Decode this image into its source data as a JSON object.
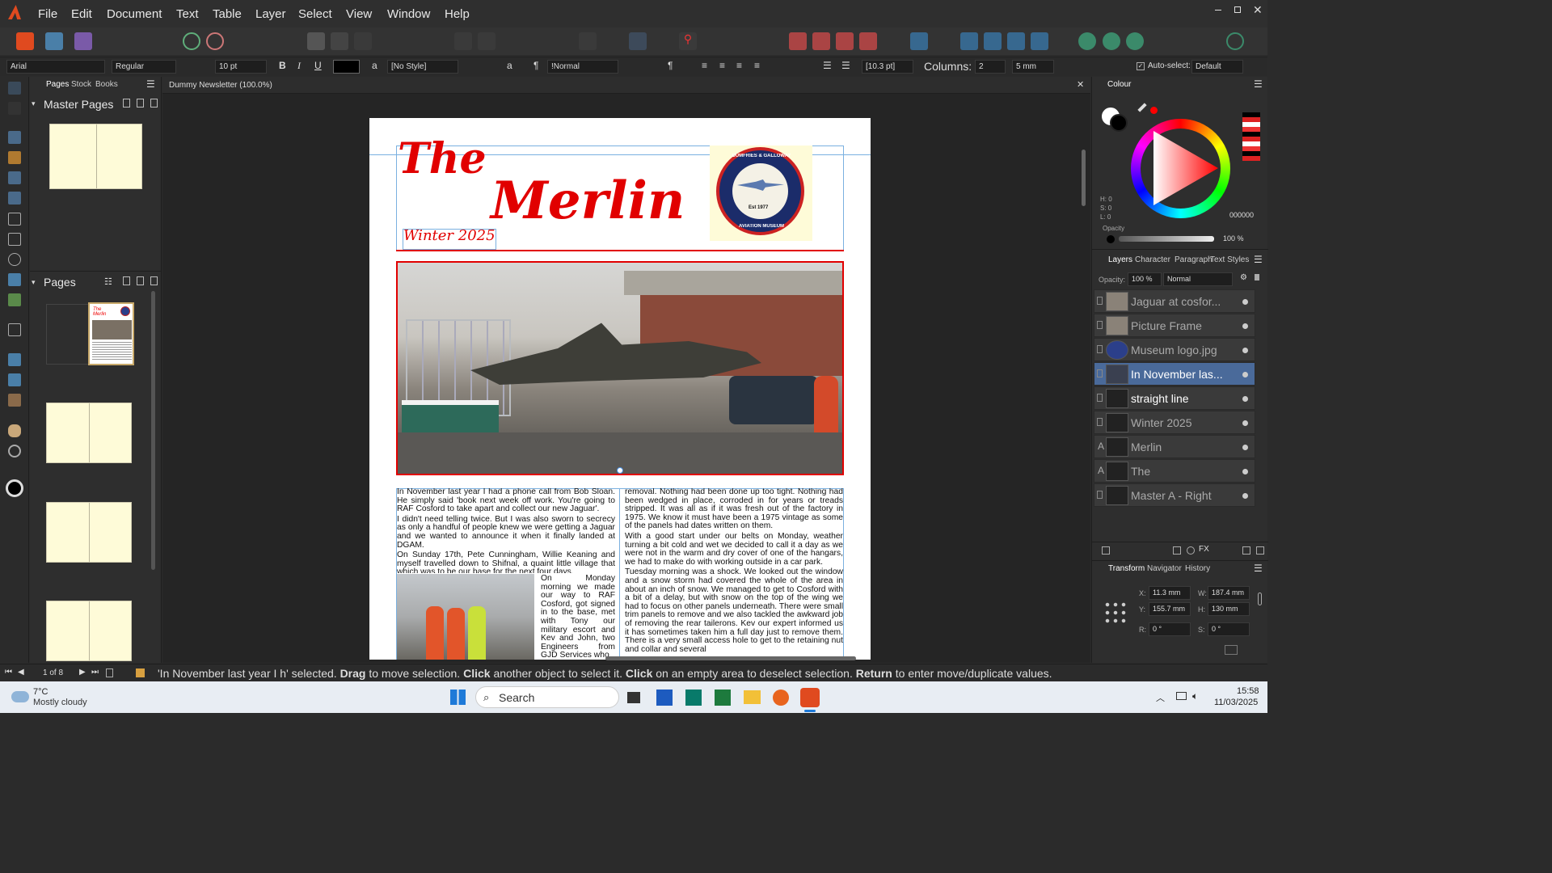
{
  "menu": {
    "items": [
      "File",
      "Edit",
      "Document",
      "Text",
      "Table",
      "Layer",
      "Select",
      "View",
      "Window",
      "Help"
    ]
  },
  "context": {
    "font": "Arial",
    "style": "Regular",
    "size": "10 pt",
    "char_style": "[No Style]",
    "para_style": "!Normal",
    "leading": "[10.3 pt]",
    "columns_label": "Columns:",
    "columns_value": "2",
    "gutter": "5 mm",
    "autoselect_label": "Auto-select:",
    "autoselect_value": "Default"
  },
  "left_panel": {
    "tabs": [
      "Pages",
      "Stock",
      "Books"
    ],
    "master_pages_label": "Master Pages",
    "pages_label": "Pages"
  },
  "document": {
    "tab_title": "Dummy Newsletter (100.0%)",
    "heading_the": "The",
    "heading_merlin": "Merlin",
    "subtitle": "Winter 2025",
    "logo_top": "DUMFRIES & GALLOWAY",
    "logo_bottom": "AVIATION MUSEUM",
    "logo_est": "Est 1977",
    "col1_p1": "In November last year I had a phone call from Bob Sloan. He simply said 'book next week off work. You're going to RAF Cosford to take apart and collect our new Jaguar'.",
    "col1_p2": "I didn't need telling twice. But I was also sworn to secrecy as only a handful of people knew we were getting a Jaguar and we wanted to announce it when it finally landed at DGAM.",
    "col1_p3": "On Sunday 17th, Pete Cunningham, Willie Keaning and myself travelled down to Shifnal, a quaint little village that which was to be our base for the next four days.",
    "col1_p4": "On Monday morning we made our way to RAF Cosford, got signed in to the base, met with Tony our military escort and Kev and John, two Engineers from GJD Services who",
    "col2_p1": "removal. Nothing had been done up too tight. Nothing had been wedged in place, corroded in for years or treads stripped. It was all as if it was fresh out of the factory in 1975. We know it must have been a 1975 vintage as some of the panels had dates written on them.",
    "col2_p2": "With a good start under our belts on Monday, weather turning a bit cold and wet we decided to call it a day as we were not in the warm and dry cover of one of the hangars, we had to make do with working outside in a car park.",
    "col2_p3": "Tuesday morning was a shock. We looked out the window and a snow storm had covered the whole of the area in about an inch of snow. We managed to get to Cosford with a bit of a delay, but with snow on the top of the wing we had to focus on other panels underneath. There were small trim panels to remove and we also tackled the awkward job of removing the rear tailerons. Kev our expert informed us it has sometimes taken him a full day just to remove them. There is a very small access hole to get to the retaining nut and collar and several"
  },
  "right_panel": {
    "colour_tab": "Colour",
    "hsl": [
      "H: 0",
      "S: 0",
      "L: 0"
    ],
    "hex": "000000",
    "opacity_label": "Opacity",
    "opacity_value": "100 %",
    "tabs": [
      "Layers",
      "Character",
      "Paragraph",
      "Text Styles"
    ],
    "layer_opacity_label": "Opacity:",
    "layer_opacity": "100 %",
    "blend": "Normal",
    "layers": [
      "Jaguar at cosfor...",
      "Picture Frame",
      "Museum logo.jpg",
      "In November las...",
      "straight line",
      "Winter 2025",
      "Merlin",
      "The",
      "Master A - Right"
    ],
    "bottom_tabs": [
      "Transform",
      "Navigator",
      "History"
    ],
    "transform": {
      "x_label": "X:",
      "x": "11.3 mm",
      "y_label": "Y:",
      "y": "155.7 mm",
      "w_label": "W:",
      "w": "187.4 mm",
      "h_label": "H:",
      "h": "130 mm",
      "r_label": "R:",
      "r": "0 °",
      "s_label": "S:",
      "s": "0 °"
    }
  },
  "status": {
    "page_counter": "1 of 8",
    "message_selected": "'In November last year I h' selected.",
    "k1": "Drag",
    "m1": "to move selection.",
    "k2": "Click",
    "m2": "another object to select it.",
    "k3": "Click",
    "m3": "on an empty area to deselect selection.",
    "k4": "Return",
    "m4": "to enter move/duplicate values."
  },
  "taskbar": {
    "temp": "7°C",
    "weather": "Mostly cloudy",
    "search": "Search",
    "time": "15:58",
    "date": "11/03/2025"
  },
  "colors": {
    "accent_red": "#e10000",
    "layer_selected": "#4a6a9a",
    "panel": "#2e2e2e"
  }
}
